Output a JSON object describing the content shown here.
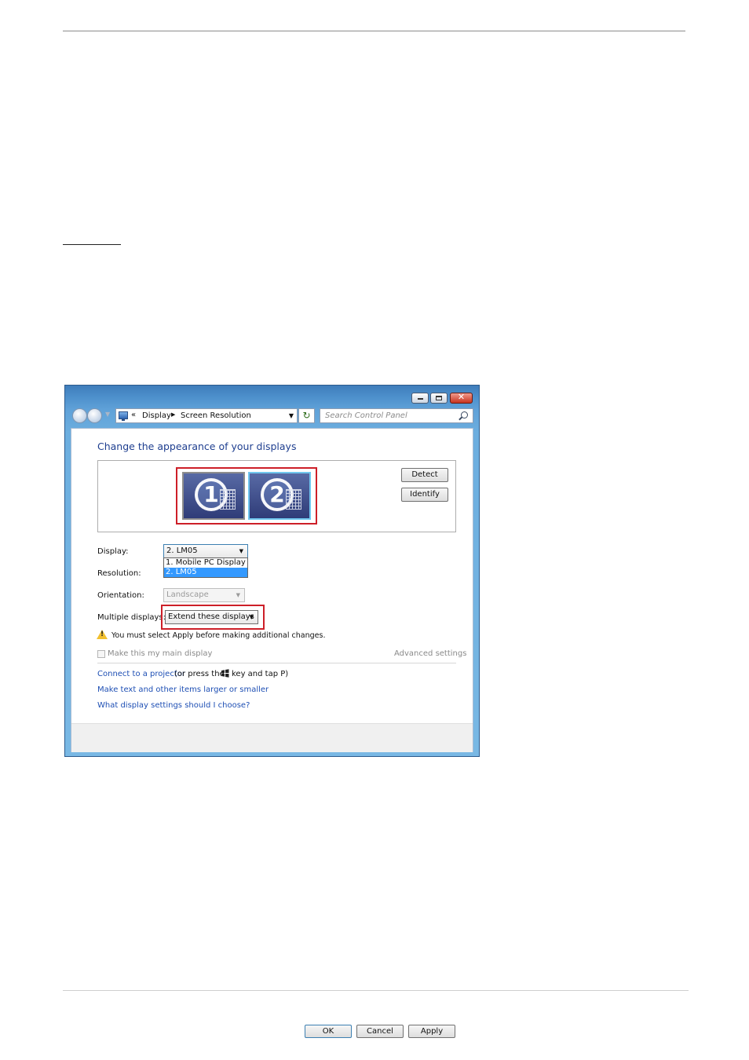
{
  "window": {
    "address": {
      "chevron": "«",
      "crumbs": [
        "Display",
        "Screen Resolution"
      ]
    },
    "search": {
      "placeholder": "Search Control Panel"
    }
  },
  "content": {
    "heading": "Change the appearance of your displays",
    "monitors": [
      {
        "number": "1"
      },
      {
        "number": "2"
      }
    ],
    "detect_button": "Detect",
    "identify_button": "Identify",
    "display": {
      "label": "Display:",
      "value": "2. LM05",
      "options": [
        "1. Mobile PC Display",
        "2. LM05"
      ],
      "selected_index": 1
    },
    "resolution": {
      "label": "Resolution:"
    },
    "orientation": {
      "label": "Orientation:",
      "value": "Landscape"
    },
    "multiple_displays": {
      "label": "Multiple displays:",
      "value": "Extend these displays"
    },
    "warning": "You must select Apply before making additional changes.",
    "main_display_checkbox": {
      "label": "Make this my main display",
      "checked": false
    },
    "advanced_settings": "Advanced settings",
    "projector_link": "Connect to a projector",
    "projector_text_before": "(or press the",
    "projector_text_after": "key and tap P)",
    "larger_text_link": "Make text and other items larger or smaller",
    "settings_help_link": "What display settings should I choose?",
    "ok_button": "OK",
    "cancel_button": "Cancel",
    "apply_button": "Apply"
  },
  "colors": {
    "link": "#1e4fb4",
    "heading": "#1e3e8f",
    "highlight_outline": "#cd1f28",
    "selected_option": "#3399ff"
  }
}
